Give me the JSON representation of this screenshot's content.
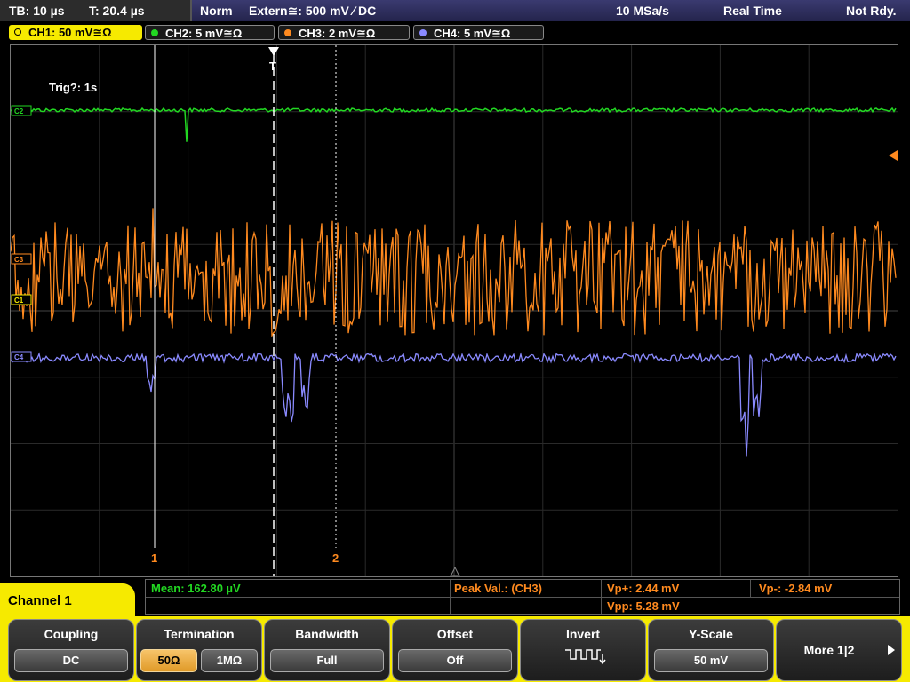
{
  "status_bar": {
    "timebase": "TB: 10 µs",
    "trigger_time": "T: 20.4 µs",
    "mode": "Norm",
    "trigger_source": "Extern≅: 500 mV ⁄ DC",
    "sample_rate": "10 MSa/s",
    "acquisition": "Real Time",
    "state": "Not Rdy."
  },
  "channels": [
    {
      "label": "CH1: 50 mV≅Ω",
      "color": "#f6ea00",
      "active": true
    },
    {
      "label": "CH2: 5 mV≅Ω",
      "color": "#22d822",
      "active": false
    },
    {
      "label": "CH3: 2 mV≅Ω",
      "color": "#ff8a1f",
      "active": false
    },
    {
      "label": "CH4: 5 mV≅Ω",
      "color": "#8a8aff",
      "active": false
    }
  ],
  "screen": {
    "trigger_info": "Trig?: 1s",
    "trigger_marker": "T",
    "cursor_1_label": "1",
    "cursor_2_label": "2",
    "trace_markers": {
      "ch2": "C2",
      "ch3": "C3",
      "ch1": "C1",
      "ch4": "C4"
    }
  },
  "measurements": {
    "mean": "Mean: 162.80 µV",
    "peak_label": "Peak Val.:  (CH3)",
    "vp_plus": "Vp+: 2.44 mV",
    "vp_minus": "Vp-: -2.84 mV",
    "vpp": "Vpp: 5.28 mV"
  },
  "menu": {
    "channel_label": "Channel 1",
    "coupling": {
      "title": "Coupling",
      "value": "DC"
    },
    "termination": {
      "title": "Termination",
      "opt1": "50Ω",
      "opt2": "1MΩ",
      "selected": "50Ω"
    },
    "bandwidth": {
      "title": "Bandwidth",
      "value": "Full"
    },
    "offset": {
      "title": "Offset",
      "value": "Off"
    },
    "invert": {
      "title": "Invert",
      "icon": "invert-waveform-icon"
    },
    "y_scale": {
      "title": "Y-Scale",
      "value": "50 mV"
    },
    "more": {
      "label": "More 1|2",
      "icon": "arrow-right-icon"
    }
  },
  "colors": {
    "ch1": "#f6ea00",
    "ch2": "#22d822",
    "ch3": "#ff8a1f",
    "ch4": "#8a8aff",
    "status_band": "#2e2e60"
  }
}
